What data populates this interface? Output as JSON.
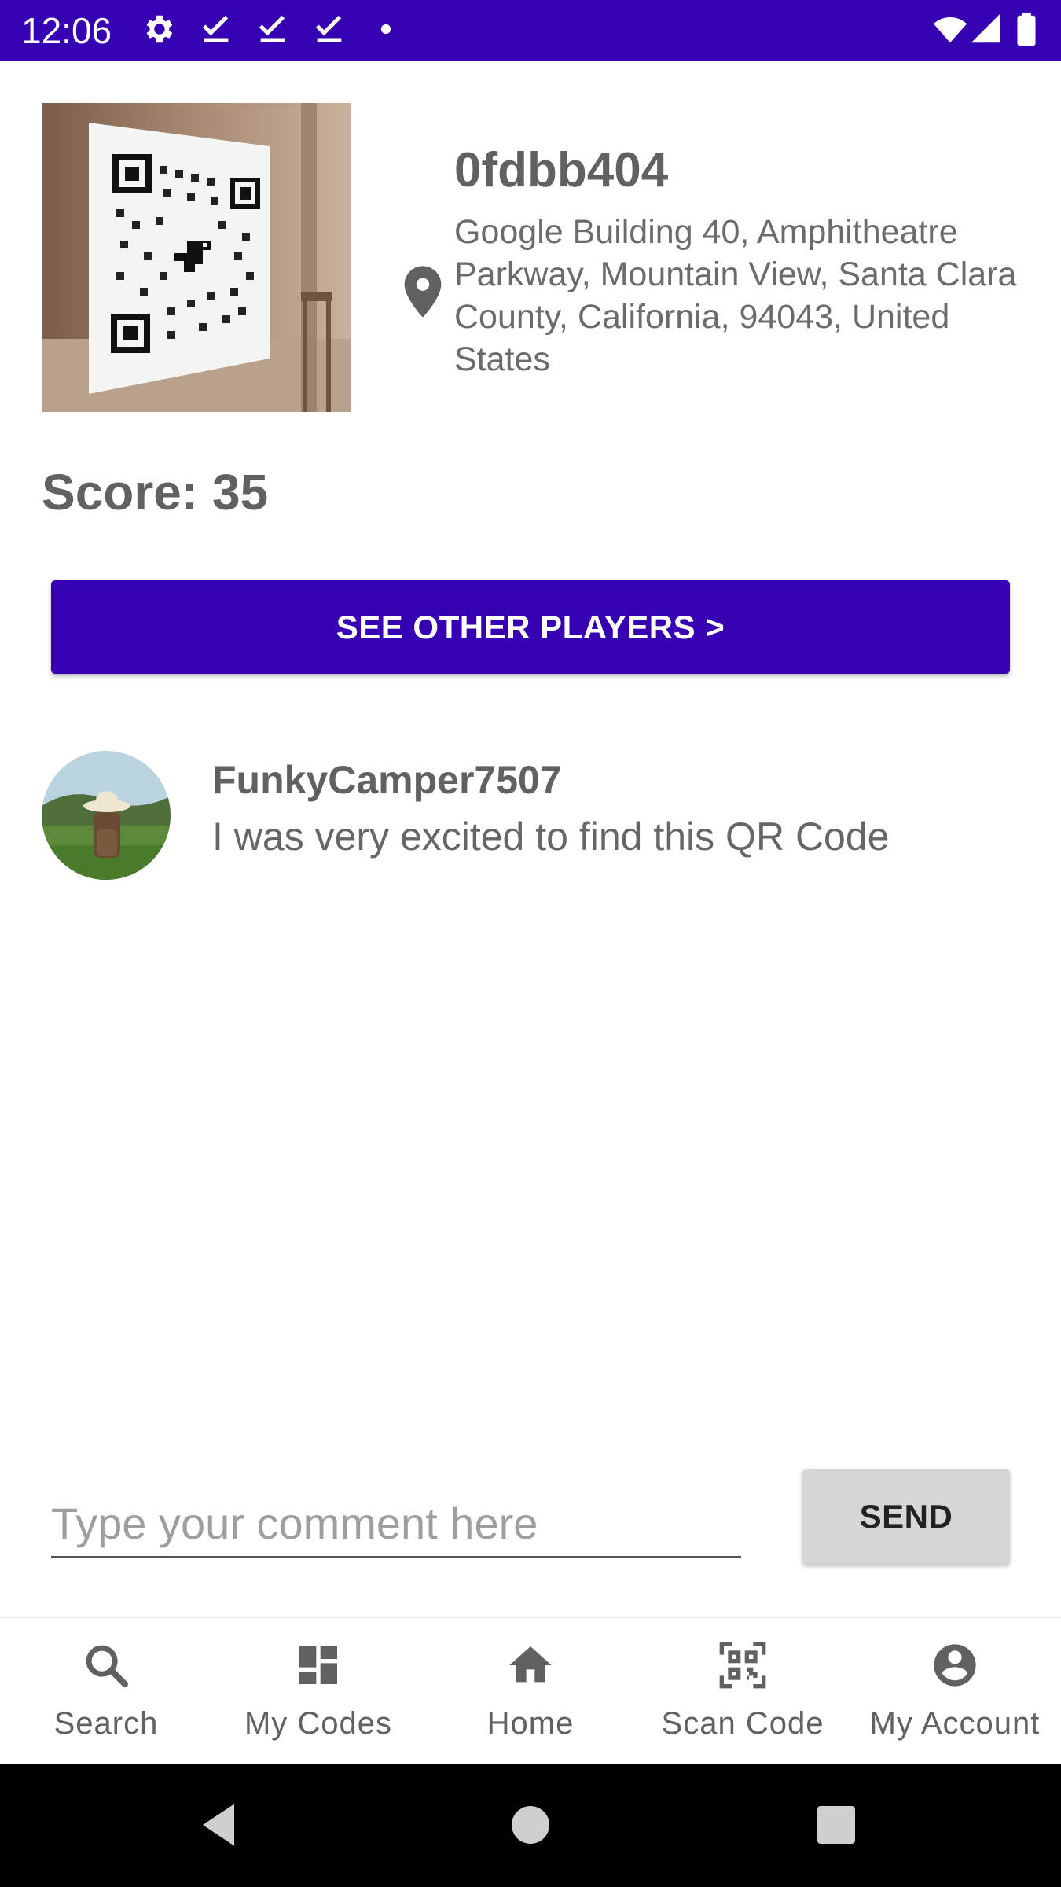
{
  "status_bar": {
    "time": "12:06",
    "icons": [
      "gear-icon",
      "check-download-icon",
      "check-download-icon",
      "check-download-icon",
      "dot-icon"
    ],
    "right_icons": [
      "wifi-icon",
      "signal-icon",
      "battery-icon"
    ],
    "background": "#3700b3"
  },
  "qr": {
    "image_icon": "qr-code-photo",
    "code_id": "0fdbb404",
    "location_icon": "map-pin-icon",
    "address": "Google Building 40, Amphitheatre Parkway, Mountain View, Santa Clara County, California, 94043, United States",
    "score_label": "Score:",
    "score_value": "35"
  },
  "see_other_players_button": {
    "label": "SEE OTHER PLAYERS >",
    "color": "#3700b3"
  },
  "comments": [
    {
      "avatar": "user-avatar",
      "username": "FunkyCamper7507",
      "text": "I was very excited to find this QR Code"
    }
  ],
  "comment_box": {
    "placeholder": "Type your comment here",
    "value": "",
    "send_label": "SEND"
  },
  "bottom_nav": {
    "items": [
      {
        "label": "Search",
        "icon": "search-icon"
      },
      {
        "label": "My Codes",
        "icon": "dashboard-icon"
      },
      {
        "label": "Home",
        "icon": "home-icon"
      },
      {
        "label": "Scan Code",
        "icon": "qr-scan-icon"
      },
      {
        "label": "My Account",
        "icon": "account-icon"
      }
    ]
  },
  "system_nav": {
    "buttons": [
      "back-icon",
      "home-circle-icon",
      "recents-icon"
    ]
  }
}
